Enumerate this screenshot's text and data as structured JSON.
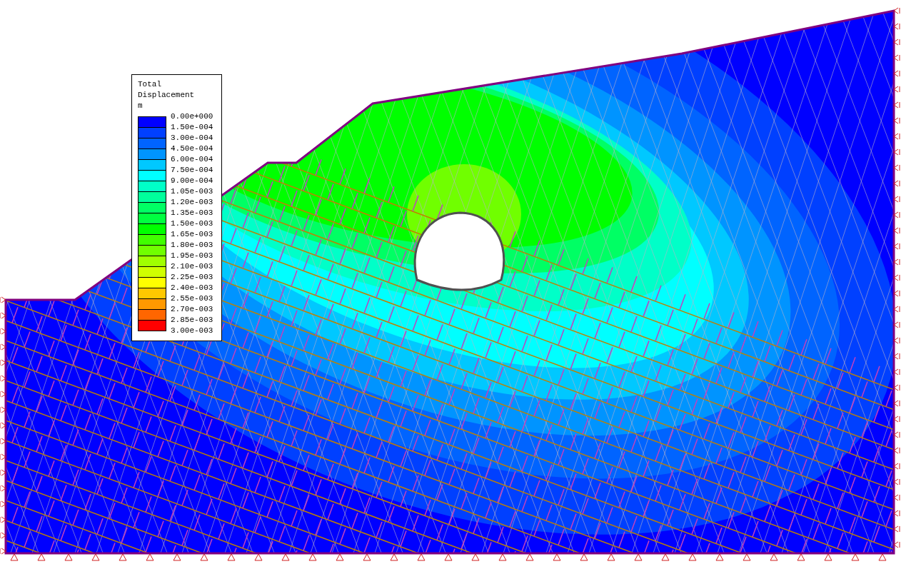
{
  "legend": {
    "title": "Total Displacement",
    "unit": "m",
    "bands": [
      {
        "color": "#0000ff"
      },
      {
        "color": "#0040ff"
      },
      {
        "color": "#0064ff"
      },
      {
        "color": "#0094ff"
      },
      {
        "color": "#00c8ff"
      },
      {
        "color": "#00ffff"
      },
      {
        "color": "#00ffc8"
      },
      {
        "color": "#00ff9c"
      },
      {
        "color": "#00ff64"
      },
      {
        "color": "#00ff40"
      },
      {
        "color": "#00ff00"
      },
      {
        "color": "#40ff00"
      },
      {
        "color": "#70ff00"
      },
      {
        "color": "#a0ff00"
      },
      {
        "color": "#d0ff00"
      },
      {
        "color": "#ffff00"
      },
      {
        "color": "#ffc800"
      },
      {
        "color": "#ff9900"
      },
      {
        "color": "#ff6600"
      },
      {
        "color": "#ff0000"
      }
    ],
    "ticks": [
      "0.00e+000",
      "1.50e-004",
      "3.00e-004",
      "4.50e-004",
      "6.00e-004",
      "7.50e-004",
      "9.00e-004",
      "1.05e-003",
      "1.20e-003",
      "1.35e-003",
      "1.50e-003",
      "1.65e-003",
      "1.80e-003",
      "1.95e-003",
      "2.10e-003",
      "2.25e-003",
      "2.40e-003",
      "2.55e-003",
      "2.70e-003",
      "2.85e-003",
      "3.00e-003"
    ]
  }
}
